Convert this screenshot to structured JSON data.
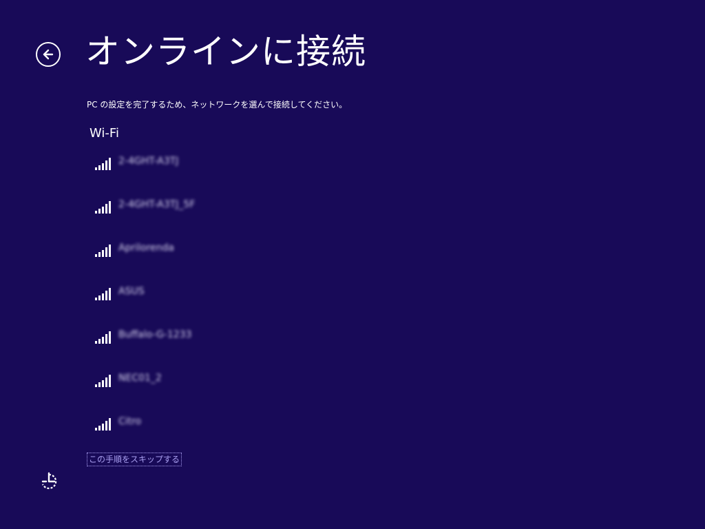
{
  "header": {
    "title": "オンラインに接続",
    "back_icon": "back-arrow-icon"
  },
  "subtitle": "PC の設定を完了するため、ネットワークを選んで接続してください。",
  "wifi": {
    "section_title": "Wi-Fi",
    "signal_icon": "wifi-signal-icon",
    "networks": [
      {
        "name": "2-4GHT-A3TJ"
      },
      {
        "name": "2-4GHT-A3TJ_5F"
      },
      {
        "name": "Aprilorenda"
      },
      {
        "name": "ASUS"
      },
      {
        "name": "Buffalo-G-1233"
      },
      {
        "name": "NEC01_2"
      },
      {
        "name": "Citro"
      }
    ]
  },
  "skip_link": "この手順をスキップする",
  "footer": {
    "accessibility_icon": "ease-of-access-icon"
  },
  "colors": {
    "background": "#180a58",
    "text": "#ffffff",
    "link": "#a99ff0"
  }
}
